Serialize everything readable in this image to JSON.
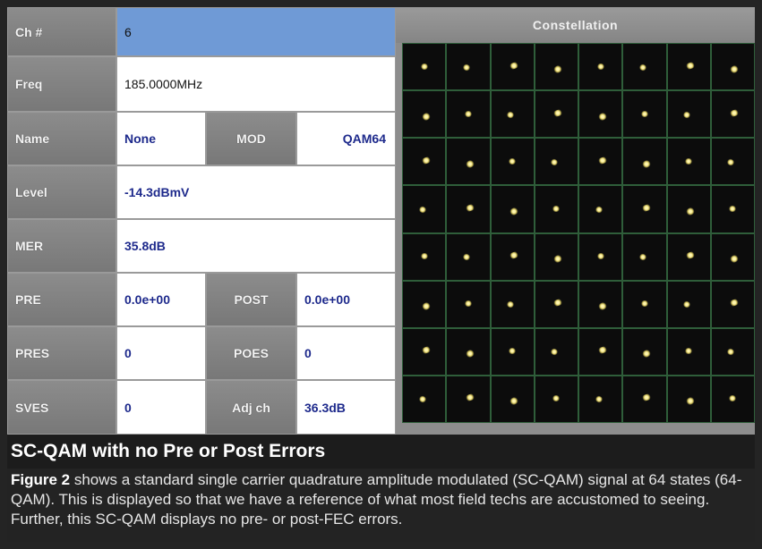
{
  "fields": {
    "ch_label": "Ch #",
    "ch_value": "6",
    "freq_label": "Freq",
    "freq_value": "185.0000MHz",
    "name_label": "Name",
    "name_value": "None",
    "mod_label": "MOD",
    "mod_value": "QAM64",
    "level_label": "Level",
    "level_value": "-14.3dBmV",
    "mer_label": "MER",
    "mer_value": "35.8dB",
    "pre_label": "PRE",
    "pre_value": "0.0e+00",
    "post_label": "POST",
    "post_value": "0.0e+00",
    "pres_label": "PRES",
    "pres_value": "0",
    "poes_label": "POES",
    "poes_value": "0",
    "sves_label": "SVES",
    "sves_value": "0",
    "adjch_label": "Adj ch",
    "adjch_value": "36.3dB"
  },
  "constellation": {
    "title": "Constellation",
    "rows": 8,
    "cols": 8
  },
  "caption": {
    "heading": "SC-QAM with no Pre or Post Errors",
    "figure_ref": "Figure 2",
    "body": " shows a standard single carrier quadrature amplitude modulated (SC-QAM) signal at 64 states (64-QAM). This is displayed so that we have a reference of what most field techs are accustomed to seeing. Further, this SC-QAM displays no pre- or post-FEC errors."
  },
  "colors": {
    "channel_value_bg": "#6f9ad6",
    "value_text": "#1e2a8c",
    "grid_line": "#2f5e3a",
    "symbol": "#f0e6a0"
  }
}
